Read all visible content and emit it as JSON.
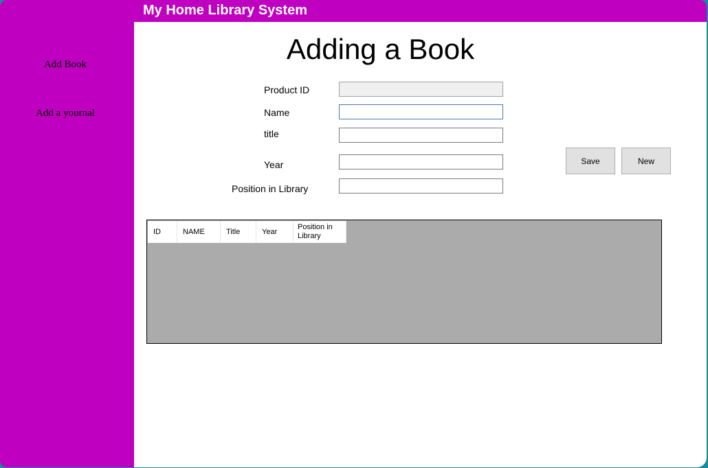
{
  "window": {
    "title": "My Home Library System"
  },
  "sidebar": {
    "items": [
      {
        "label": "Add Book"
      },
      {
        "label": "Add a yournal"
      }
    ]
  },
  "form": {
    "heading": "Adding a Book",
    "fields": [
      {
        "label": "Product ID",
        "value": ""
      },
      {
        "label": "Name",
        "value": ""
      },
      {
        "label": "title",
        "value": ""
      },
      {
        "label": "Year",
        "value": ""
      },
      {
        "label": "Position in Library",
        "value": ""
      }
    ],
    "buttons": {
      "save": "Save",
      "new": "New"
    }
  },
  "grid": {
    "columns": [
      "ID",
      "NAME",
      "Title",
      "Year",
      "Position in Library"
    ],
    "rows": []
  },
  "colors": {
    "accent": "#c000c0",
    "grid_background": "#ababab",
    "desktop": "#1a8a9a"
  }
}
